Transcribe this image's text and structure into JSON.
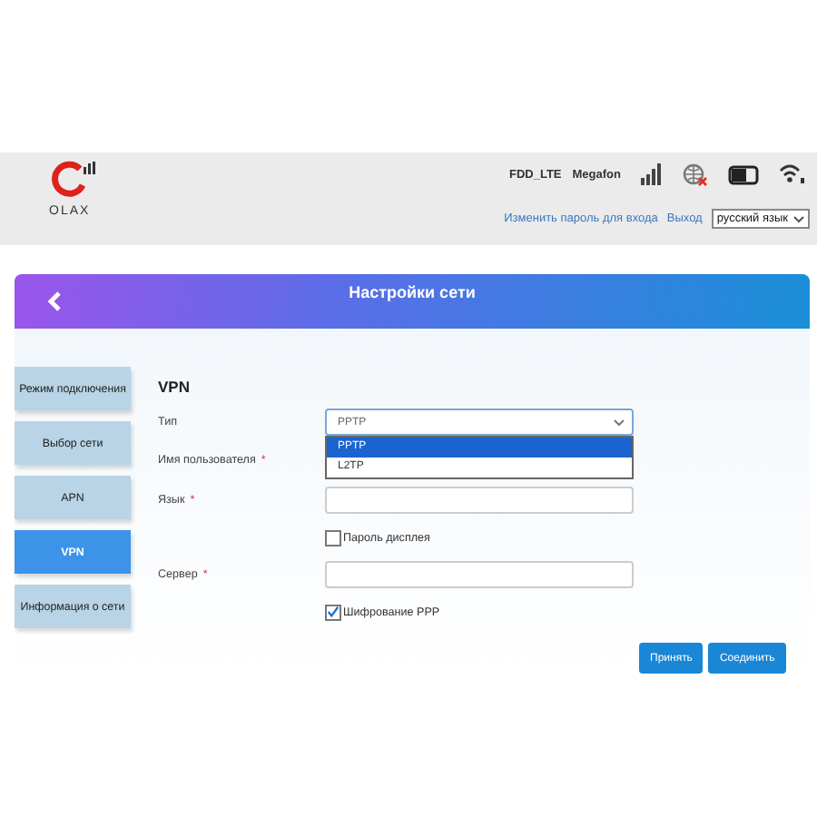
{
  "header": {
    "logo_text": "OLAX",
    "network_type": "FDD_LTE",
    "operator": "Megafon",
    "links": [
      {
        "label": "Изменить пароль для входа"
      },
      {
        "label": "Выход"
      }
    ],
    "language": "русский язык"
  },
  "card": {
    "title": "Настройки сети"
  },
  "sidebar": {
    "items": [
      {
        "label": "Режим подключения",
        "selected": false
      },
      {
        "label": "Выбор сети",
        "selected": false
      },
      {
        "label": "APN",
        "selected": false
      },
      {
        "label": "VPN",
        "selected": true
      },
      {
        "label": "Информация о сети",
        "selected": false
      }
    ]
  },
  "form": {
    "title": "VPN",
    "rows": [
      {
        "kind": "select",
        "label": "Тип",
        "value": "PPTP",
        "options": [
          {
            "label": "PPTP",
            "selected": true
          },
          {
            "label": "L2TP",
            "selected": false
          }
        ]
      },
      {
        "kind": "hidden",
        "label": "Имя пользователя",
        "required_mark": "*"
      },
      {
        "kind": "text",
        "label": "Язык",
        "required_mark": "*"
      },
      {
        "kind": "checkbox",
        "label": "Пароль дисплея",
        "checked": false
      },
      {
        "kind": "text",
        "label": "Сервер",
        "required_mark": "*"
      },
      {
        "kind": "checkbox",
        "label": "Шифрование PPP",
        "checked": true
      }
    ],
    "buttons": [
      {
        "label": "Принять"
      },
      {
        "label": "Соединить"
      }
    ]
  }
}
